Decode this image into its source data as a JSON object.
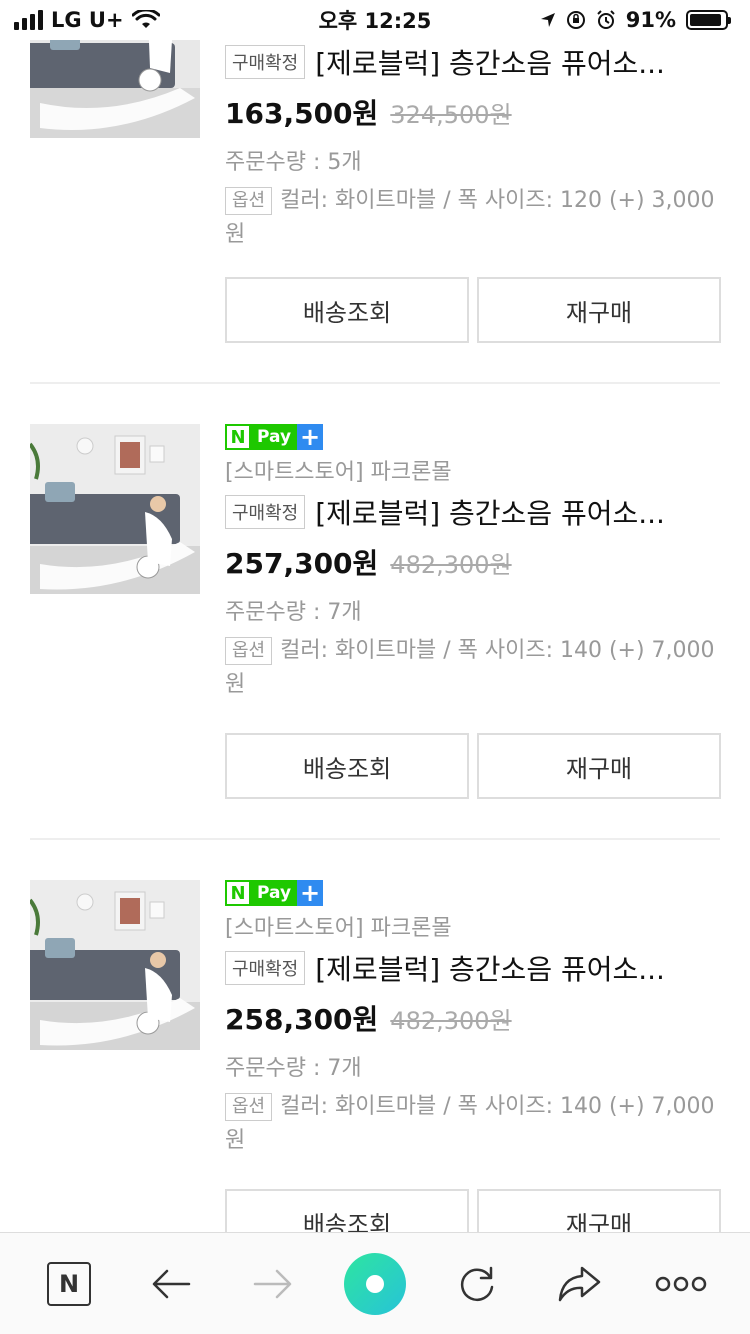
{
  "status_bar": {
    "carrier": "LG U+",
    "time": "오후 12:25",
    "battery": "91%",
    "battery_level": 0.91
  },
  "orders": [
    {
      "has_npay": false,
      "store": "",
      "status_badge": "구매확정",
      "product_name": "[제로블럭] 층간소음 퓨어소...",
      "price": "163,500원",
      "original_price": "324,500원",
      "quantity": "주문수량 : 5개",
      "option_badge": "옵션",
      "option_text": "컬러: 화이트마블 / 폭 사이즈: 120 (+) 3,000원",
      "buttons": [
        "배송조회",
        "재구매"
      ]
    },
    {
      "has_npay": true,
      "store": "[스마트스토어] 파크론몰",
      "status_badge": "구매확정",
      "product_name": "[제로블럭] 층간소음 퓨어소...",
      "price": "257,300원",
      "original_price": "482,300원",
      "quantity": "주문수량 : 7개",
      "option_badge": "옵션",
      "option_text": "컬러: 화이트마블 / 폭 사이즈: 140 (+) 7,000원",
      "buttons": [
        "배송조회",
        "재구매"
      ]
    },
    {
      "has_npay": true,
      "store": "[스마트스토어] 파크론몰",
      "status_badge": "구매확정",
      "product_name": "[제로블럭] 층간소음 퓨어소...",
      "price": "258,300원",
      "original_price": "482,300원",
      "quantity": "주문수량 : 7개",
      "option_badge": "옵션",
      "option_text": "컬러: 화이트마블 / 폭 사이즈: 140 (+) 7,000원",
      "buttons": [
        "배송조회",
        "재구매"
      ]
    }
  ],
  "npay": {
    "n": "N",
    "pay": "Pay",
    "plus": "+"
  },
  "toolbar": {
    "n_label": "N",
    "icons": [
      "naver-home-icon",
      "back-arrow-icon",
      "forward-arrow-icon",
      "green-dot-icon",
      "refresh-icon",
      "share-icon",
      "more-icon"
    ]
  }
}
